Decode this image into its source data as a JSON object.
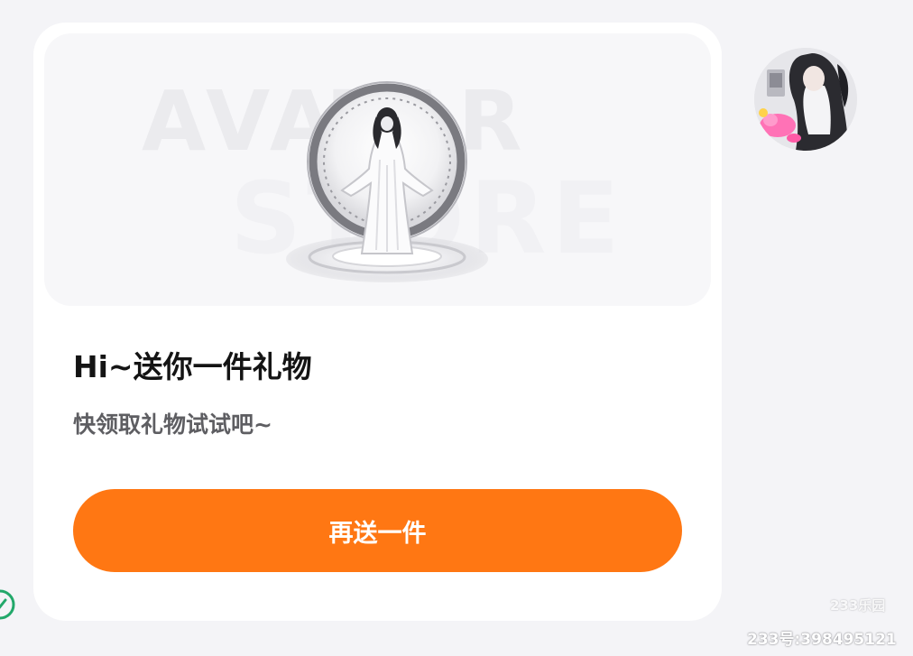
{
  "gift_card": {
    "watermark_line1": "AVATAR",
    "watermark_line2": "STORE",
    "title": "Hi~送你一件礼物",
    "subtitle": "快领取礼物试试吧~",
    "cta_label": "再送一件",
    "cta_color": "#ff7713"
  },
  "watermark": {
    "brand": "233乐园",
    "account_id": "233号:398495121"
  },
  "icons": {
    "avatar": "user-avatar-photo",
    "check": "check-circle-icon",
    "figure": "white-robed-avatar-figure"
  }
}
